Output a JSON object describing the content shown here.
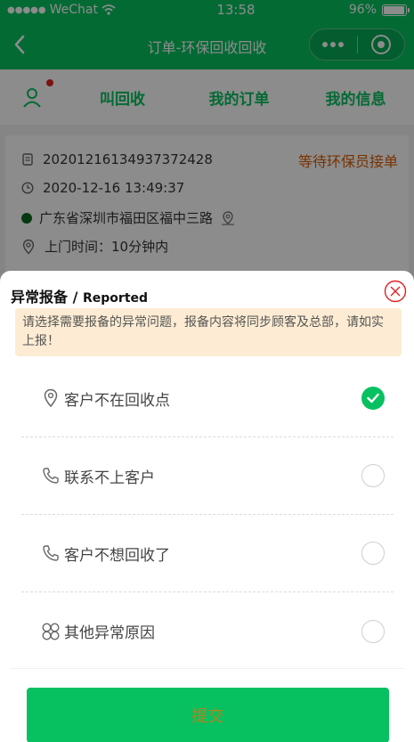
{
  "status_bar": {
    "carrier": "WeChat",
    "time": "13:58",
    "battery": "96%",
    "battery_level": 0.96
  },
  "nav": {
    "title": "订单-环保回收回收"
  },
  "tabs": [
    {
      "label": "叫回收"
    },
    {
      "label": "我的订单"
    },
    {
      "label": "我的信息"
    }
  ],
  "order": {
    "number": "20201216134937372428",
    "status": "等待环保员接单",
    "time": "2020-12-16 13:49:37",
    "address": "广东省深圳市福田区福中三路",
    "visit_time": "上门时间：10分钟内"
  },
  "sheet": {
    "title": "异常报备",
    "title_sep": " / ",
    "title_en": "Reported",
    "notice": "请选择需要报备的异常问题，报备内容将同步顾客及总部，请如实上报！",
    "options": [
      {
        "label": "客户不在回收点",
        "icon": "location-icon",
        "checked": true
      },
      {
        "label": "联系不上客户",
        "icon": "phone-icon",
        "checked": false
      },
      {
        "label": "客户不想回收了",
        "icon": "phone-icon",
        "checked": false
      },
      {
        "label": "其他异常原因",
        "icon": "clover-icon",
        "checked": false
      }
    ],
    "submit_label": "提交"
  },
  "colors": {
    "primary": "#07c160",
    "status_orange": "#d95b00",
    "notice_bg": "#fdecd3",
    "close_red": "#e02020",
    "submit_text": "#b3831f"
  }
}
